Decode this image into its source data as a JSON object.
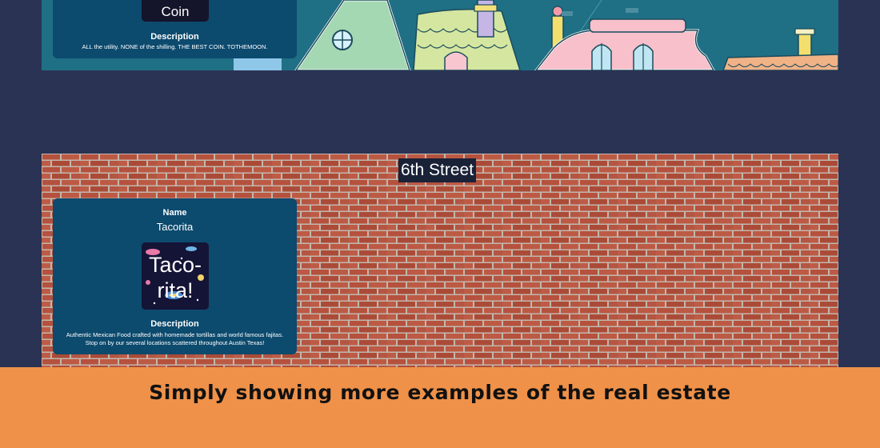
{
  "top_panel": {
    "card": {
      "thumb_text": "Coin",
      "description_title": "Description",
      "description_text": "ALL the utility. NONE of the shilling. THE BEST COIN. TOTHEMOON."
    }
  },
  "brick_panel": {
    "title": "6th Street",
    "card": {
      "name_title": "Name",
      "name_value": "Tacorita",
      "thumb_text_line1": "Taco-",
      "thumb_text_line2": "rita!",
      "description_title": "Description",
      "description_text": "Authentic Mexican Food crafted with homemade tortillas and world famous fajitas. Stop on by our several locations scattered throughout Austin Texas!"
    }
  },
  "caption": {
    "text": "Simply showing more examples of the real estate"
  },
  "colors": {
    "page_background": "#2a3354",
    "card_background": "#0c4a6e",
    "caption_background": "#ef9149",
    "brick": "#b85640",
    "houses_background": "#1f6f85"
  },
  "icons": {
    "top_thumb": "coin-image",
    "brick_thumb": "tacorita-image"
  }
}
